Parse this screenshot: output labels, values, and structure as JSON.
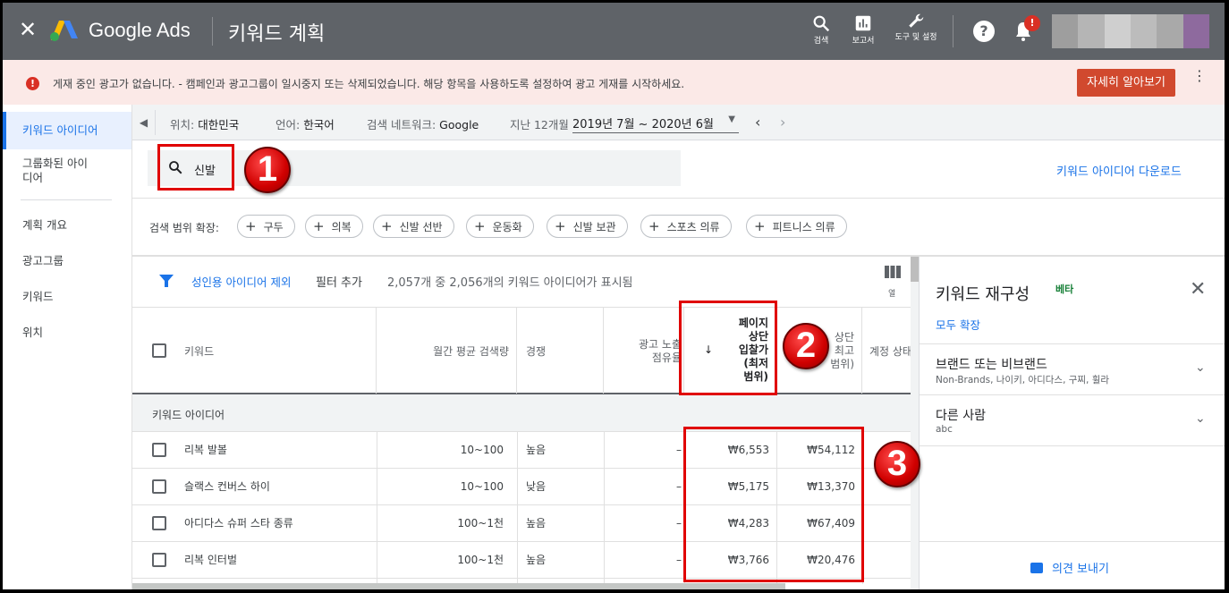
{
  "header": {
    "close_icon": "close-icon",
    "brand": "Google Ads",
    "title": "키워드 계획",
    "buttons": [
      {
        "label": "검색",
        "icon": "search-icon"
      },
      {
        "label": "보고서",
        "icon": "report-icon"
      },
      {
        "label": "도구 및 설정",
        "icon": "wrench-icon"
      }
    ],
    "help_icon": "help-icon",
    "notification_badge": "!",
    "colors": {
      "header_bg": "#5f6368",
      "accent": "#1a73e8",
      "alert_red": "#d93025"
    }
  },
  "alert": {
    "text": "게재 중인 광고가 없습니다. - 캠페인과 광고그룹이 일시중지 또는 삭제되었습니다. 해당 항목을 사용하도록 설정하여 광고 게재를 시작하세요.",
    "button": "자세히 알아보기"
  },
  "sidebar": {
    "items": [
      {
        "label": "키워드 아이디어"
      },
      {
        "label": "그룹화된 아이디어"
      },
      {
        "label": "계획 개요"
      },
      {
        "label": "광고그룹"
      },
      {
        "label": "키워드"
      },
      {
        "label": "위치"
      }
    ]
  },
  "location_bar": {
    "location_key": "위치:",
    "location_value": "대한민국",
    "language_key": "언어:",
    "language_value": "한국어",
    "network_key": "검색 네트워크:",
    "network_value": "Google",
    "period_key": "지난 12개월",
    "date_range": "2019년 7월 ~ 2020년 6월"
  },
  "search": {
    "query": "신발",
    "download_link": "키워드 아이디어 다운로드"
  },
  "expand": {
    "label": "검색 범위 확장:",
    "chips": [
      "구두",
      "의복",
      "신발 선반",
      "운동화",
      "신발 보관",
      "스포츠 의류",
      "피트니스 의류"
    ]
  },
  "filters": {
    "exclude_adult": "성인용 아이디어 제외",
    "add_filter": "필터 추가",
    "count_text": "2,057개 중 2,056개의 키워드 아이디어가 표시됨",
    "columns_label": "열"
  },
  "table": {
    "headers": {
      "keyword": "키워드",
      "monthly": "월간 평균 검색량",
      "competition": "경쟁",
      "impr_1": "광고 노출",
      "impr_2": "점유율",
      "sort_arrow": "↓",
      "low_1": "페이지",
      "low_2": "상단",
      "low_3": "입찰가",
      "low_4": "(최저",
      "low_5": "범위)",
      "high_1": "상단",
      "high_2": "최고",
      "high_3": "범위)",
      "account": "계정 상태"
    },
    "group_label": "키워드 아이디어",
    "rows": [
      {
        "keyword": "리복 발볼",
        "monthly": "10~100",
        "competition": "높음",
        "impression": "–",
        "low": "₩6,553",
        "high": "₩54,112"
      },
      {
        "keyword": "슬랙스 컨버스 하이",
        "monthly": "10~100",
        "competition": "낮음",
        "impression": "–",
        "low": "₩5,175",
        "high": "₩13,370"
      },
      {
        "keyword": "아디다스 슈퍼 스타 종류",
        "monthly": "100~1천",
        "competition": "높음",
        "impression": "–",
        "low": "₩4,283",
        "high": "₩67,409"
      },
      {
        "keyword": "리복 인터벌",
        "monthly": "100~1천",
        "competition": "높음",
        "impression": "–",
        "low": "₩3,766",
        "high": "₩20,476"
      }
    ]
  },
  "refine_panel": {
    "title": "키워드 재구성",
    "beta": "베타",
    "expand_all": "모두 확장",
    "sections": [
      {
        "title": "브랜드 또는 비브랜드",
        "subtitle": "Non-Brands, 나이키, 아디다스, 구찌, 휠라"
      },
      {
        "title": "다른 사람",
        "subtitle": "abc"
      }
    ],
    "feedback": "의견 보내기"
  },
  "annotations": {
    "n1": "1",
    "n2": "2",
    "n3": "3"
  }
}
